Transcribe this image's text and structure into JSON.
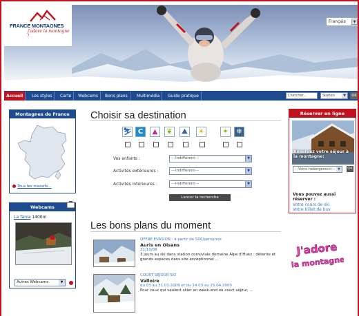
{
  "header": {
    "logo_name": "FRANCE MONTAGNES",
    "logo_tagline": "j'adore la montagne !",
    "language": "Français"
  },
  "nav": {
    "tabs": [
      "Accueil",
      "Les styles",
      "Carte",
      "Webcams",
      "Bons plans",
      "Multimédia",
      "Guide pratique"
    ],
    "active_tab": "Accueil",
    "search_placeholder": "Chercher...",
    "search_scope": "Station",
    "search_go": "OK"
  },
  "map_box": {
    "title": "Montagnes de France",
    "link": "Tous les massifs..."
  },
  "webcam_box": {
    "title": "Webcams",
    "station_link": "La Tania",
    "altitude": "1400m",
    "select_value": "Autres Webcams"
  },
  "destination": {
    "title": "Choisir sa destination",
    "fields": [
      {
        "label": "Vos enfants :",
        "value": "---Indifférent---"
      },
      {
        "label": "Activités extérieures :",
        "value": "---Indifférent---"
      },
      {
        "label": "Activités intérieures :",
        "value": "---Indifférent---"
      }
    ],
    "search_button": "Lancer la recherche",
    "activity_icons": [
      "ski-icon",
      "station-c-icon",
      "alpine-icon",
      "leaf-icon",
      "hiking-icon",
      "sun-icon",
      "walker-icon",
      "snowflake-icon"
    ]
  },
  "deals": {
    "title": "Les bons plans du moment",
    "items": [
      {
        "tag": "OFFRE EVASION",
        "tag_extra": " : à partir de 50€/personne",
        "name": "Auris en Oisans",
        "date": "31/10/08",
        "desc": "3 jours au ski dans station conviviale domaine Alpe d'Huez : détente et grands espaces dans site exceptionnel ..."
      },
      {
        "tag": "COURT SEJOUR SKI",
        "tag_extra": "",
        "name": "Valloire",
        "date": "du 03 au 31.01.2009 et du 14.03 au 25.04.2009",
        "desc": "Pour ceux qui veulent skier en week-end ou court séjour. ..."
      }
    ]
  },
  "reserve_box": {
    "title": "Réserver en ligne",
    "caption": "Réservez votre séjour à la montagne:",
    "select_value": "---Votre hébergement---",
    "go": "OK",
    "also_title": "Vous pouvez aussi réserver :",
    "links": [
      "Votre cours de ski",
      "Votre billet de bus"
    ]
  },
  "badge": {
    "line1": "J'adore",
    "line2": "la montagne !"
  }
}
